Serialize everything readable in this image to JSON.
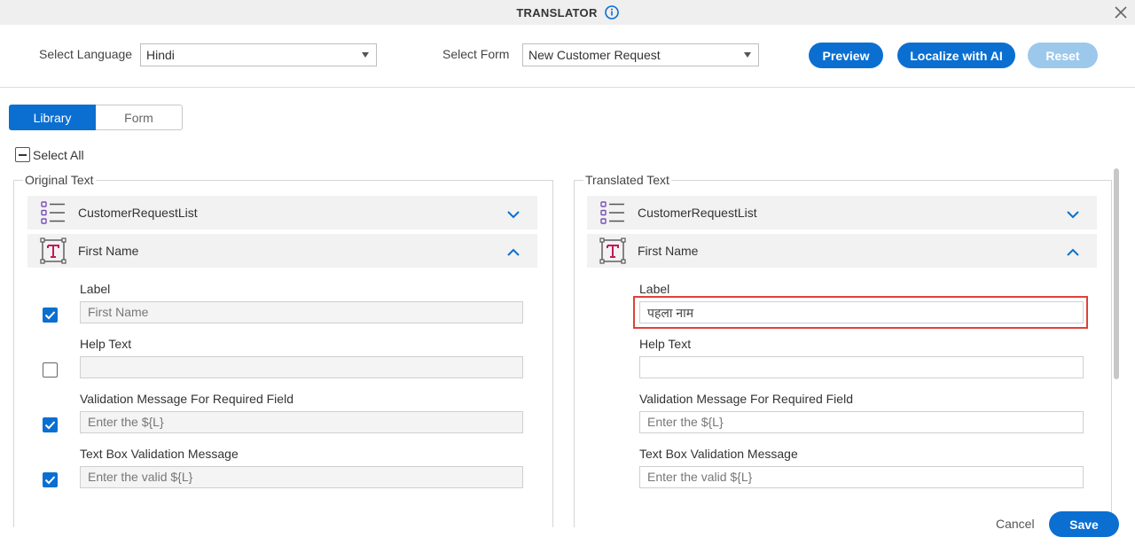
{
  "window": {
    "title": "TRANSLATOR",
    "close_icon": "close-icon",
    "info_icon": "info-icon"
  },
  "toolbar": {
    "language_label": "Select Language",
    "language_value": "Hindi",
    "form_label": "Select Form",
    "form_value": "New Customer Request",
    "preview_label": "Preview",
    "localize_label": "Localize with AI",
    "reset_label": "Reset"
  },
  "tabs": [
    {
      "label": "Library",
      "active": true
    },
    {
      "label": "Form",
      "active": false
    }
  ],
  "select_all_label": "Select All",
  "original": {
    "legend": "Original Text",
    "rows": [
      {
        "name": "CustomerRequestList",
        "icon": "list-icon",
        "expanded": false
      },
      {
        "name": "First Name",
        "icon": "text-field-icon",
        "expanded": true
      }
    ],
    "fields": [
      {
        "label": "Label",
        "value": "First Name",
        "checked": true
      },
      {
        "label": "Help Text",
        "value": "",
        "checked": false
      },
      {
        "label": "Validation Message For Required Field",
        "value": "Enter the ${L}",
        "checked": true
      },
      {
        "label": "Text Box Validation Message",
        "value": "Enter the valid ${L}",
        "checked": true
      }
    ]
  },
  "translated": {
    "legend": "Translated Text",
    "rows": [
      {
        "name": "CustomerRequestList",
        "icon": "list-icon",
        "expanded": false
      },
      {
        "name": "First Name",
        "icon": "text-field-icon",
        "expanded": true
      }
    ],
    "fields": [
      {
        "label": "Label",
        "value": "पहला नाम"
      },
      {
        "label": "Help Text",
        "value": ""
      },
      {
        "label": "Validation Message For Required Field",
        "value": "Enter the ${L}"
      },
      {
        "label": "Text Box Validation Message",
        "value": "Enter the valid ${L}"
      }
    ]
  },
  "footer": {
    "cancel_label": "Cancel",
    "save_label": "Save"
  },
  "colors": {
    "accent": "#0a6fd1",
    "accent_disabled": "#9cc8ec",
    "highlight": "#e0403a",
    "icon_purple": "#7a4fb5",
    "icon_pink": "#c2185b"
  }
}
